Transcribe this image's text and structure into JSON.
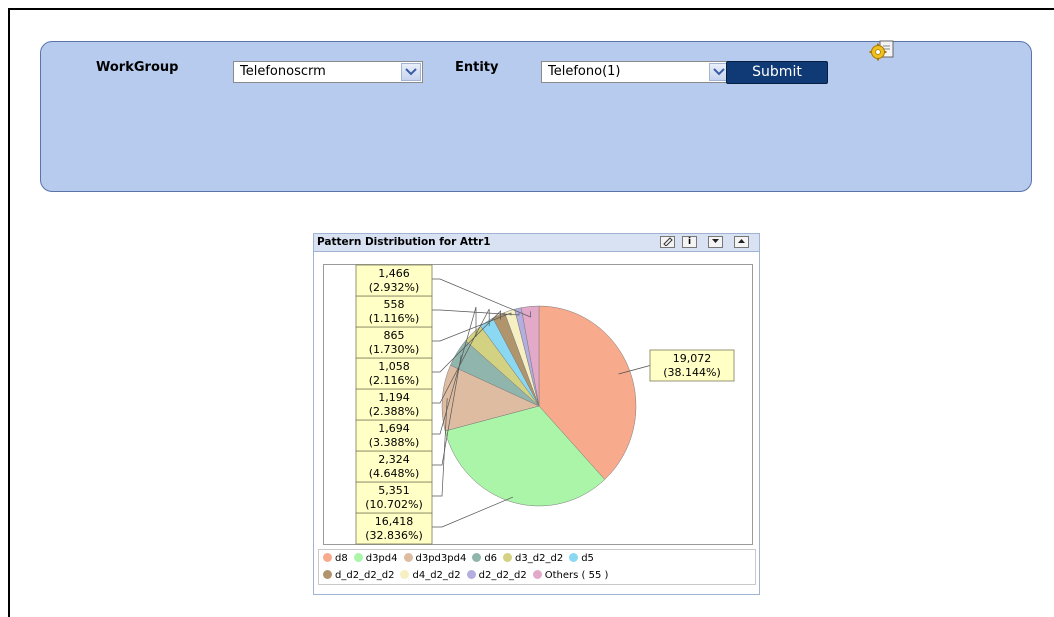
{
  "form": {
    "workgroup_label": "WorkGroup",
    "workgroup_value": "Telefonoscrm",
    "entity_label": "Entity",
    "entity_value": "Telefono(1)",
    "submit_label": "Submit",
    "settings_icon": "gear-document-icon"
  },
  "portlet": {
    "title": "Pattern Distribution for Attr1",
    "buttons": [
      "edit-icon",
      "info-icon",
      "collapse-icon",
      "expand-icon"
    ]
  },
  "chart_data": {
    "type": "pie",
    "title": "Pattern Distribution for Attr1",
    "legend_position": "bottom",
    "slices": [
      {
        "name": "d8",
        "value": 19072,
        "label": "19,072",
        "percent_label": "(38.144%)",
        "color": "#f7aa8c"
      },
      {
        "name": "d3pd4",
        "value": 16418,
        "label": "16,418",
        "percent_label": "(32.836%)",
        "color": "#aaf5a8"
      },
      {
        "name": "d3pd3pd4",
        "value": 5351,
        "label": "5,351",
        "percent_label": "(10.702%)",
        "color": "#ddbca1"
      },
      {
        "name": "d6",
        "value": 2324,
        "label": "2,324",
        "percent_label": "(4.648%)",
        "color": "#90b5ad"
      },
      {
        "name": "d3_d2_d2",
        "value": 1694,
        "label": "1,694",
        "percent_label": "(3.388%)",
        "color": "#d2d282"
      },
      {
        "name": "d5",
        "value": 1194,
        "label": "1,194",
        "percent_label": "(2.388%)",
        "color": "#8ad8f2"
      },
      {
        "name": "d_d2_d2_d2",
        "value": 1058,
        "label": "1,058",
        "percent_label": "(2.116%)",
        "color": "#b0956c"
      },
      {
        "name": "d4_d2_d2",
        "value": 865,
        "label": "865",
        "percent_label": "(1.730%)",
        "color": "#f5efc2"
      },
      {
        "name": "d2_d2_d2",
        "value": 558,
        "label": "558",
        "percent_label": "(1.116%)",
        "color": "#b4aee0"
      },
      {
        "name": "Others ( 55 )",
        "value": 1466,
        "label": "1,466",
        "percent_label": "(2.932%)",
        "color": "#e2a9c8"
      }
    ]
  }
}
